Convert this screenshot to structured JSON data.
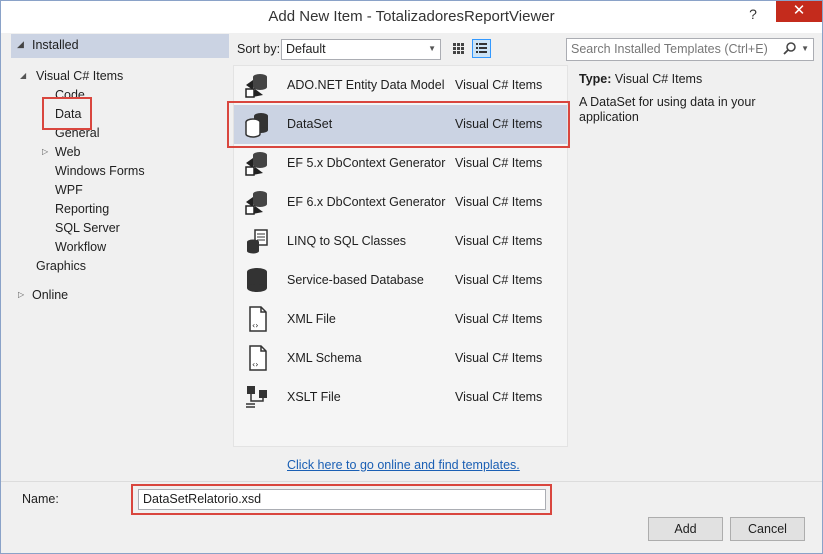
{
  "window": {
    "title": "Add New Item - TotalizadoresReportViewer",
    "help_label": "?",
    "close_label": "✕"
  },
  "tree": {
    "installed": "Installed",
    "visual_csharp_items": "Visual C# Items",
    "children": [
      "Code",
      "Data",
      "General",
      "Web",
      "Windows Forms",
      "WPF",
      "Reporting",
      "SQL Server",
      "Workflow"
    ],
    "graphics": "Graphics",
    "online": "Online"
  },
  "toolbar": {
    "sort_by_label": "Sort by:",
    "sort_value": "Default",
    "search_placeholder": "Search Installed Templates (Ctrl+E)"
  },
  "templates": [
    {
      "name": "ADO.NET Entity Data Model",
      "category": "Visual C# Items",
      "icon": "entity-model-icon"
    },
    {
      "name": "DataSet",
      "category": "Visual C# Items",
      "icon": "dataset-icon"
    },
    {
      "name": "EF 5.x DbContext Generator",
      "category": "Visual C# Items",
      "icon": "dbcontext-generator-icon"
    },
    {
      "name": "EF 6.x DbContext Generator",
      "category": "Visual C# Items",
      "icon": "dbcontext-generator-icon"
    },
    {
      "name": "LINQ to SQL Classes",
      "category": "Visual C# Items",
      "icon": "linq-to-sql-icon"
    },
    {
      "name": "Service-based Database",
      "category": "Visual C# Items",
      "icon": "database-icon"
    },
    {
      "name": "XML File",
      "category": "Visual C# Items",
      "icon": "xml-file-icon"
    },
    {
      "name": "XML Schema",
      "category": "Visual C# Items",
      "icon": "xml-schema-icon"
    },
    {
      "name": "XSLT File",
      "category": "Visual C# Items",
      "icon": "xslt-file-icon"
    }
  ],
  "online_link": "Click here to go online and find templates.",
  "details": {
    "type_label": "Type:",
    "type_value": "Visual C# Items",
    "description": "A DataSet for using data in your application"
  },
  "bottom": {
    "name_label": "Name:",
    "name_value": "DataSetRelatorio.xsd",
    "add_label": "Add",
    "cancel_label": "Cancel"
  },
  "colors": {
    "selection": "#cbd3e3",
    "highlight_border": "#d9463e",
    "link": "#1a5fb4",
    "close_button": "#c42b1c"
  }
}
